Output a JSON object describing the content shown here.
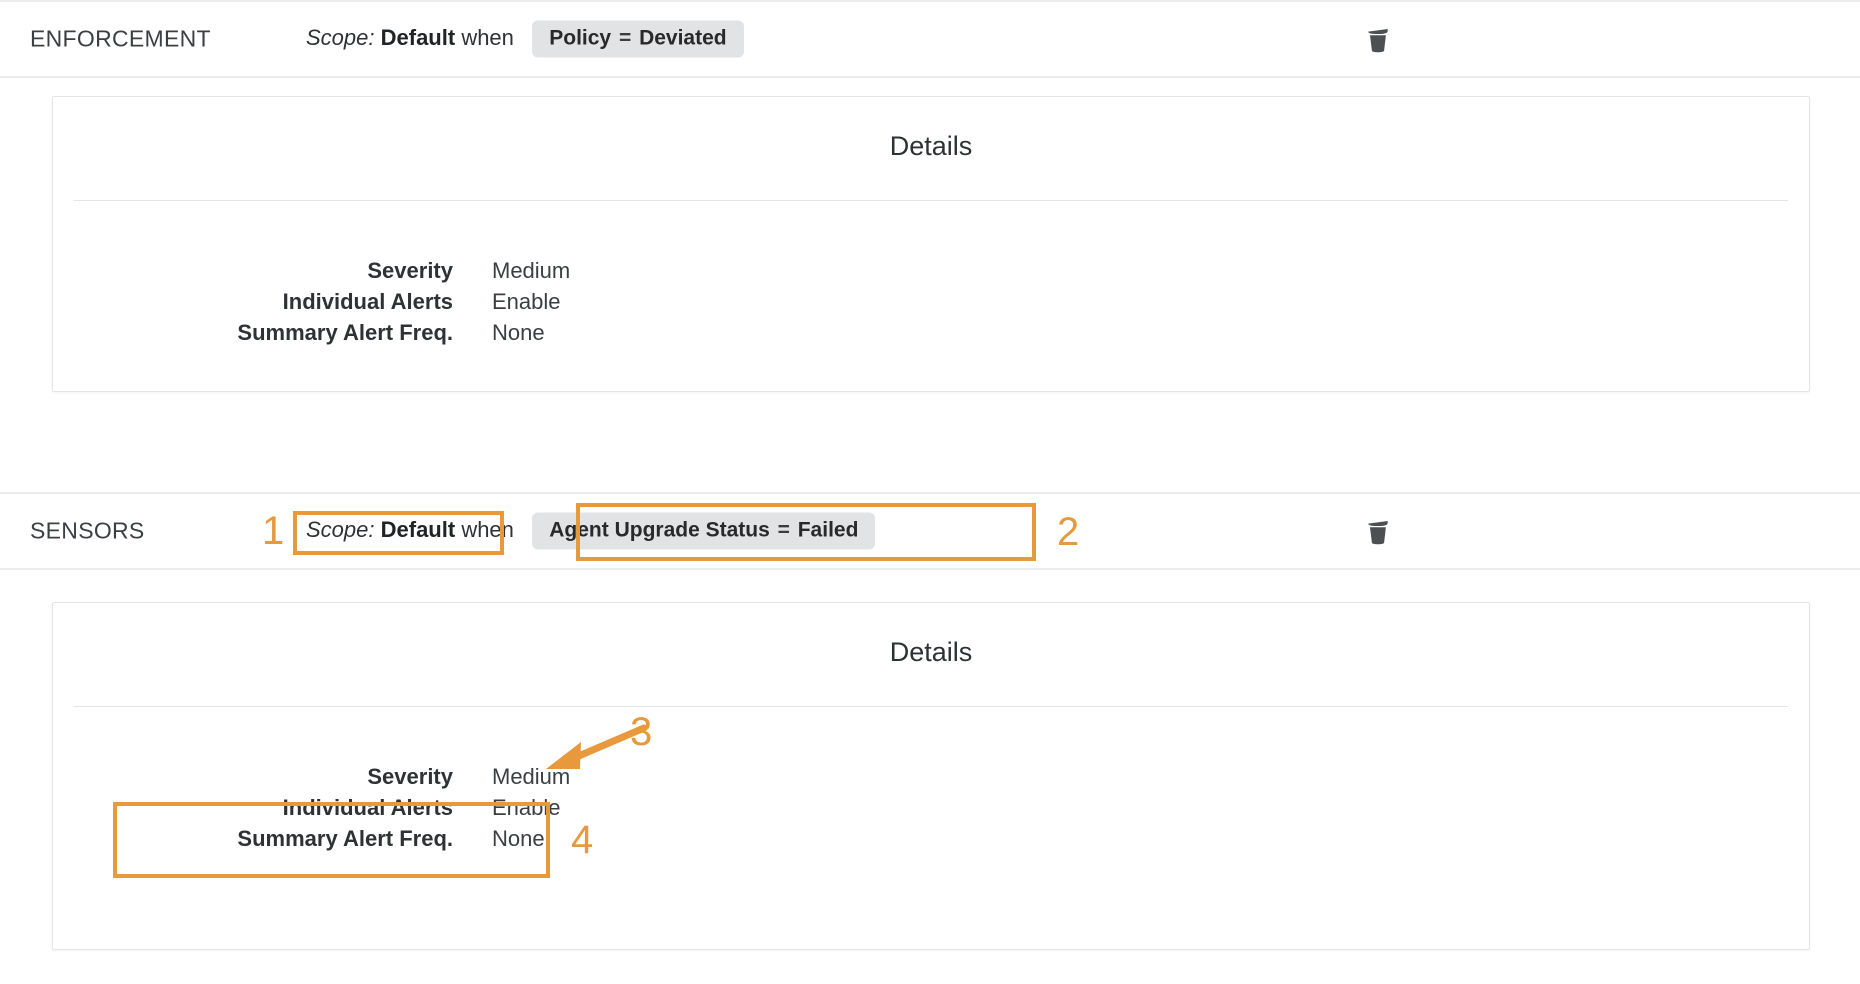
{
  "theme": {
    "accent_orange": "#e7993c",
    "chip_bg": "#e2e3e4",
    "border_gray": "#e3e4e5",
    "text_dark": "#2f3234"
  },
  "sections": [
    {
      "title": "ENFORCEMENT",
      "scope_label": "Scope:",
      "scope_value": "Default",
      "when": "when",
      "chip": {
        "field": "Policy",
        "operator": "=",
        "value": "Deviated"
      },
      "delete_icon": "trash-icon",
      "details": {
        "title": "Details",
        "rows": [
          {
            "key": "Severity",
            "value": "Medium"
          },
          {
            "key": "Individual Alerts",
            "value": "Enable"
          },
          {
            "key": "Summary Alert Freq.",
            "value": "None"
          }
        ]
      }
    },
    {
      "title": "SENSORS",
      "scope_label": "Scope:",
      "scope_value": "Default",
      "when": "when",
      "chip": {
        "field": "Agent Upgrade Status",
        "operator": "=",
        "value": "Failed"
      },
      "delete_icon": "trash-icon",
      "details": {
        "title": "Details",
        "rows": [
          {
            "key": "Severity",
            "value": "Medium"
          },
          {
            "key": "Individual Alerts",
            "value": "Enable"
          },
          {
            "key": "Summary Alert Freq.",
            "value": "None"
          }
        ]
      }
    }
  ],
  "annotations": [
    {
      "number": "1",
      "target": "sensors-scope-expression"
    },
    {
      "number": "2",
      "target": "sensors-condition-chip"
    },
    {
      "number": "3",
      "target": "sensors-severity-value"
    },
    {
      "number": "4",
      "target": "sensors-alert-rows"
    }
  ]
}
